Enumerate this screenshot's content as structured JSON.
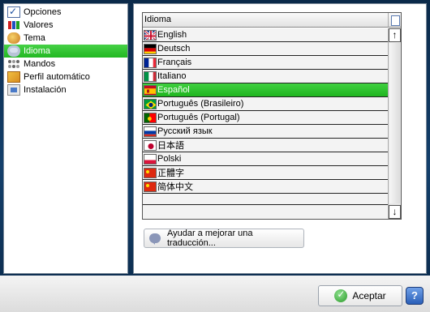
{
  "sidebar": {
    "items": [
      {
        "label": "Opciones",
        "icon": "checkbox-icon"
      },
      {
        "label": "Valores",
        "icon": "values-icon"
      },
      {
        "label": "Tema",
        "icon": "palette-icon"
      },
      {
        "label": "Idioma",
        "icon": "speech-bubble-icon",
        "selected": true
      },
      {
        "label": "Mandos",
        "icon": "controller-icon"
      },
      {
        "label": "Perfil automático",
        "icon": "profile-icon"
      },
      {
        "label": "Instalación",
        "icon": "install-icon"
      }
    ]
  },
  "language_list": {
    "header": "Idioma",
    "rows": [
      {
        "label": "English",
        "flag": "uk-flag-icon"
      },
      {
        "label": "Deutsch",
        "flag": "germany-flag-icon"
      },
      {
        "label": "Français",
        "flag": "france-flag-icon"
      },
      {
        "label": "Italiano",
        "flag": "italy-flag-icon"
      },
      {
        "label": "Español",
        "flag": "spain-flag-icon",
        "selected": true
      },
      {
        "label": "Português (Brasileiro)",
        "flag": "brazil-flag-icon"
      },
      {
        "label": "Português (Portugal)",
        "flag": "portugal-flag-icon"
      },
      {
        "label": "Русский язык",
        "flag": "russia-flag-icon"
      },
      {
        "label": "日本語",
        "flag": "japan-flag-icon"
      },
      {
        "label": "Polski",
        "flag": "poland-flag-icon"
      },
      {
        "label": "正體字",
        "flag": "china-flag-icon"
      },
      {
        "label": "简体中文",
        "flag": "china-flag-icon"
      }
    ]
  },
  "help_translate_button": "Ayudar a mejorar una traducción...",
  "accept_button": "Aceptar",
  "help_icon_label": "?",
  "colors": {
    "selection_green": "#22b822",
    "background_blue": "#14406c"
  }
}
